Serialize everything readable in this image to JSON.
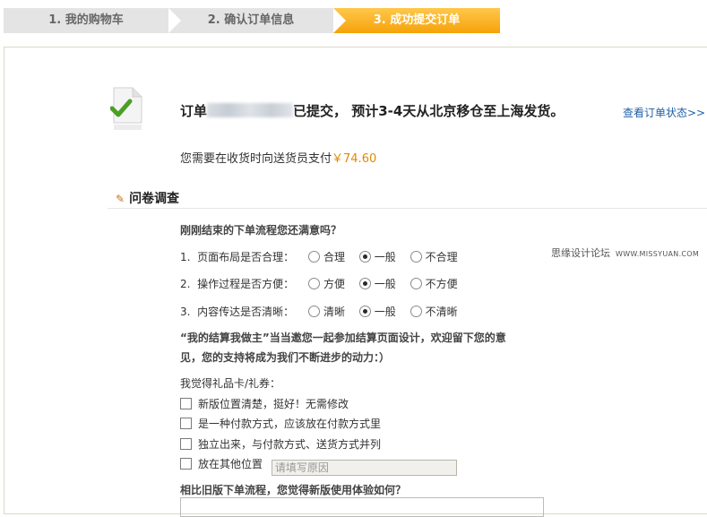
{
  "steps": [
    {
      "label": "1. 我的购物车",
      "state": "done"
    },
    {
      "label": "2. 确认订单信息",
      "state": "done"
    },
    {
      "label": "3. 成功提交订单",
      "state": "current"
    }
  ],
  "order": {
    "prefix": "订单",
    "suffix": "已提交， 预计3-4天从北京移仓至上海发货。",
    "status_link": "查看订单状态>>",
    "pay_text": "您需要在收货时向送货员支付",
    "amount": "￥74.60"
  },
  "survey": {
    "title": "问卷调查",
    "question": "刚刚结束的下单流程您还满意吗？",
    "items": [
      {
        "num": "1.",
        "label": "页面布局是否合理：",
        "options": [
          "合理",
          "一般",
          "不合理"
        ],
        "selected": 1
      },
      {
        "num": "2.",
        "label": "操作过程是否方便：",
        "options": [
          "方便",
          "一般",
          "不方便"
        ],
        "selected": 1
      },
      {
        "num": "3.",
        "label": "内容传达是否清晰：",
        "options": [
          "清晰",
          "一般",
          "不清晰"
        ],
        "selected": 1
      }
    ],
    "invite_line1": "“我的结算我做主”当当邀您一起参加结算页面设计，欢迎留下您的意",
    "invite_line2": "见，您的支持将成为我们不断进步的动力：）",
    "giftcard_label": "我觉得礼品卡/礼券：",
    "checkbox_options": [
      "新版位置清楚，挺好！无需修改",
      "是一种付款方式，应该放在付款方式里",
      "独立出来，与付款方式、送货方式并列",
      "放在其他位置"
    ],
    "other_placeholder": "请填写原因",
    "compare_question": "相比旧版下单流程，您觉得新版使用体验如何？"
  },
  "watermark": {
    "cn": "思缘设计论坛",
    "en": "WWW.MISSYUAN.COM"
  }
}
